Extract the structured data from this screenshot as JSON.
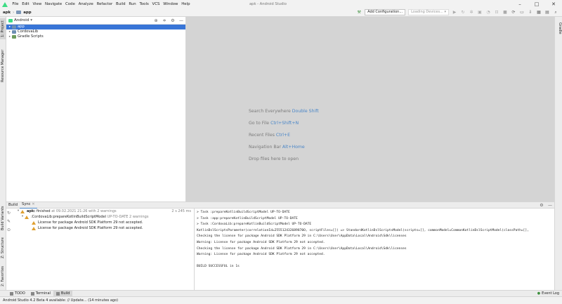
{
  "menu": [
    "File",
    "Edit",
    "View",
    "Navigate",
    "Code",
    "Analyze",
    "Refactor",
    "Build",
    "Run",
    "Tools",
    "VCS",
    "Window",
    "Help"
  ],
  "window_title": "apk - Android Studio",
  "nav": {
    "crumb_project": "apk",
    "crumb_module": "app",
    "add_config": "Add Configuration...",
    "device": "Loading Devices..."
  },
  "left_tabs": {
    "project": "1: Project",
    "resource_manager": "Resource Manager",
    "build_variants": "Build Variants",
    "structure": "Z: Structure",
    "favorites": "2: Favorites"
  },
  "right_tabs": {
    "gradle": "Gradle"
  },
  "project_panel": {
    "view_selector": "Android",
    "items": [
      {
        "label": "app",
        "selected": true
      },
      {
        "label": "CordovaLib",
        "selected": false
      },
      {
        "label": "Gradle Scripts",
        "selected": false
      }
    ]
  },
  "editor_hints": [
    {
      "text": "Search Everywhere",
      "key": "Double Shift"
    },
    {
      "text": "Go to File",
      "key": "Ctrl+Shift+N"
    },
    {
      "text": "Recent Files",
      "key": "Ctrl+E"
    },
    {
      "text": "Navigation Bar",
      "key": "Alt+Home"
    },
    {
      "text": "Drop files here to open",
      "key": ""
    }
  ],
  "build": {
    "tabs": [
      "Build",
      "Sync"
    ],
    "root": {
      "name": "apk:",
      "status": "finished",
      "detail": "at 09.02.2021 21:26 with 2 warnings",
      "time": "2 s 245 ms"
    },
    "task": {
      "name": ":CordovaLib:prepareKotlinBuildScriptModel",
      "detail": "UP-TO-DATE 2 warnings"
    },
    "warnings": [
      "License for package Android SDK Platform 29 not accepted.",
      "License for package Android SDK Platform 29 not accepted."
    ],
    "output": [
      "> Task :prepareKotlinBuildScriptModel UP-TO-DATE",
      "> Task :app:prepareKotlinBuildScriptModel UP-TO-DATE",
      "> Task :CordovaLib:prepareKotlinBuildScriptModel UP-TO-DATE",
      "KotlinDslScriptsParameter(correlationId=255512432689870O, scriptFiles=[]) => StandardKotlinDslScriptsModel(scripts=[], commonModel=CommonKotlinDslScriptModel(classPath=[],",
      "Checking the license for package Android SDK Platform 29 in C:\\Users\\User\\AppData\\Local\\Android\\Sdk\\licenses",
      "Warning: License for package Android SDK Platform 29 not accepted.",
      "Checking the license for package Android SDK Platform 29 in C:\\Users\\User\\AppData\\Local\\Android\\Sdk\\licenses",
      "Warning: License for package Android SDK Platform 29 not accepted.",
      "",
      "BUILD SUCCESSFUL in 1s"
    ]
  },
  "bottom_tabs": [
    "TODO",
    "Terminal",
    "Build"
  ],
  "event_log": "Event Log",
  "status": "Android Studio 4.2 Beta 4 available: // Update... (14 minutes ago)"
}
